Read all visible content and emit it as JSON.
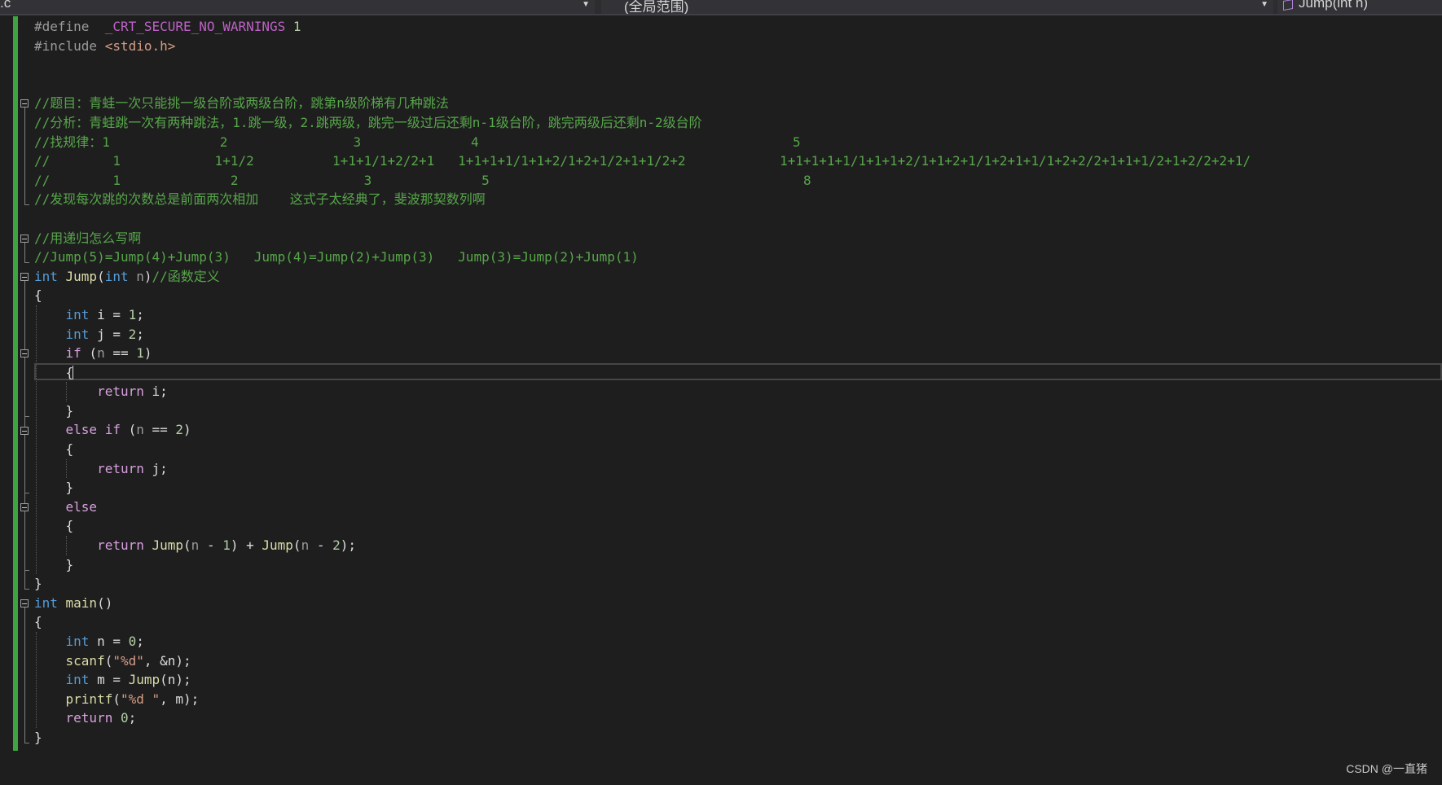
{
  "toolbar": {
    "file_dropdown": ".c",
    "scope_dropdown": "(全局范围)",
    "member_dropdown": "Jump(int n)",
    "member_icon": "method-cube-icon"
  },
  "code_lines": [
    [
      {
        "t": "#define ",
        "c": "pp"
      },
      {
        "t": " _CRT_SECURE_NO_WARNINGS",
        "c": "mc"
      },
      {
        "t": " 1",
        "c": "nm"
      }
    ],
    [
      {
        "t": "#include ",
        "c": "pp"
      },
      {
        "t": "<stdio.h>",
        "c": "st"
      }
    ],
    [],
    [],
    [
      {
        "t": "//题目：青蛙一次只能挑一级台阶或两级台阶，跳第n级阶梯有几种跳法",
        "c": "cm"
      }
    ],
    [
      {
        "t": "//分析：青蛙跳一次有两种跳法，1.跳一级，2.跳两级，跳完一级过后还剩n-1级台阶，跳完两级后还剩n-2级台阶",
        "c": "cm"
      }
    ],
    [
      {
        "t": "//找规律：1              2                3              4                                        5",
        "c": "cm"
      }
    ],
    [
      {
        "t": "//        1            1+1/2          1+1+1/1+2/2+1   1+1+1+1/1+1+2/1+2+1/2+1+1/2+2            1+1+1+1+1/1+1+1+2/1+1+2+1/1+2+1+1/1+2+2/2+1+1+1/2+1+2/2+2+1/",
        "c": "cm"
      }
    ],
    [
      {
        "t": "//        1              2                3              5                                        8",
        "c": "cm"
      }
    ],
    [
      {
        "t": "//发现每次跳的次数总是前面两次相加    这式子太经典了，斐波那契数列啊",
        "c": "cm"
      }
    ],
    [],
    [
      {
        "t": "//用递归怎么写啊",
        "c": "cm"
      }
    ],
    [
      {
        "t": "//Jump(5)=Jump(4)+Jump(3)   Jump(4)=Jump(2)+Jump(3)   Jump(3)=Jump(2)+Jump(1)",
        "c": "cm"
      }
    ],
    [
      {
        "t": "int ",
        "c": "kw"
      },
      {
        "t": "Jump",
        "c": "fn"
      },
      {
        "t": "("
      },
      {
        "t": "int ",
        "c": "kw"
      },
      {
        "t": "n",
        "c": "pa"
      },
      {
        "t": ")"
      },
      {
        "t": "//函数定义",
        "c": "cm"
      }
    ],
    [
      {
        "t": "{"
      }
    ],
    [
      {
        "t": "    "
      },
      {
        "t": "int ",
        "c": "kw"
      },
      {
        "t": "i = "
      },
      {
        "t": "1",
        "c": "nm"
      },
      {
        "t": ";"
      }
    ],
    [
      {
        "t": "    "
      },
      {
        "t": "int ",
        "c": "kw"
      },
      {
        "t": "j = "
      },
      {
        "t": "2",
        "c": "nm"
      },
      {
        "t": ";"
      }
    ],
    [
      {
        "t": "    "
      },
      {
        "t": "if ",
        "c": "ctl"
      },
      {
        "t": "("
      },
      {
        "t": "n",
        "c": "pa"
      },
      {
        "t": " == "
      },
      {
        "t": "1",
        "c": "nm"
      },
      {
        "t": ")"
      }
    ],
    [
      {
        "t": "    {"
      }
    ],
    [
      {
        "t": "        "
      },
      {
        "t": "return ",
        "c": "ctl"
      },
      {
        "t": "i;"
      }
    ],
    [
      {
        "t": "    }"
      }
    ],
    [
      {
        "t": "    "
      },
      {
        "t": "else if ",
        "c": "ctl"
      },
      {
        "t": "("
      },
      {
        "t": "n",
        "c": "pa"
      },
      {
        "t": " == "
      },
      {
        "t": "2",
        "c": "nm"
      },
      {
        "t": ")"
      }
    ],
    [
      {
        "t": "    {"
      }
    ],
    [
      {
        "t": "        "
      },
      {
        "t": "return ",
        "c": "ctl"
      },
      {
        "t": "j;"
      }
    ],
    [
      {
        "t": "    }"
      }
    ],
    [
      {
        "t": "    "
      },
      {
        "t": "else",
        "c": "ctl"
      }
    ],
    [
      {
        "t": "    {"
      }
    ],
    [
      {
        "t": "        "
      },
      {
        "t": "return ",
        "c": "ctl"
      },
      {
        "t": "Jump",
        "c": "fn"
      },
      {
        "t": "("
      },
      {
        "t": "n",
        "c": "pa"
      },
      {
        "t": " - "
      },
      {
        "t": "1",
        "c": "nm"
      },
      {
        "t": ") + "
      },
      {
        "t": "Jump",
        "c": "fn"
      },
      {
        "t": "("
      },
      {
        "t": "n",
        "c": "pa"
      },
      {
        "t": " - "
      },
      {
        "t": "2",
        "c": "nm"
      },
      {
        "t": ");"
      }
    ],
    [
      {
        "t": "    }"
      }
    ],
    [
      {
        "t": "}"
      }
    ],
    [
      {
        "t": "int ",
        "c": "kw"
      },
      {
        "t": "main",
        "c": "fn"
      },
      {
        "t": "()"
      }
    ],
    [
      {
        "t": "{"
      }
    ],
    [
      {
        "t": "    "
      },
      {
        "t": "int ",
        "c": "kw"
      },
      {
        "t": "n = "
      },
      {
        "t": "0",
        "c": "nm"
      },
      {
        "t": ";"
      }
    ],
    [
      {
        "t": "    "
      },
      {
        "t": "scanf",
        "c": "fn"
      },
      {
        "t": "("
      },
      {
        "t": "\"%d\"",
        "c": "st"
      },
      {
        "t": ", &n);"
      }
    ],
    [
      {
        "t": "    "
      },
      {
        "t": "int ",
        "c": "kw"
      },
      {
        "t": "m = "
      },
      {
        "t": "Jump",
        "c": "fn"
      },
      {
        "t": "(n);"
      }
    ],
    [
      {
        "t": "    "
      },
      {
        "t": "printf",
        "c": "fn"
      },
      {
        "t": "("
      },
      {
        "t": "\"%d \"",
        "c": "st"
      },
      {
        "t": ", m);"
      }
    ],
    [
      {
        "t": "    "
      },
      {
        "t": "return ",
        "c": "ctl"
      },
      {
        "t": "0",
        "c": "nm"
      },
      {
        "t": ";"
      }
    ],
    [
      {
        "t": "}"
      }
    ]
  ],
  "watermark": "CSDN @一直猪",
  "colors": {
    "background": "#1e1e1e",
    "comment": "#57a64a",
    "keyword": "#569cd6",
    "function": "#dcdcaa",
    "string": "#d69d85",
    "number": "#b5cea8",
    "changed_line_marker": "#3fa33f"
  }
}
